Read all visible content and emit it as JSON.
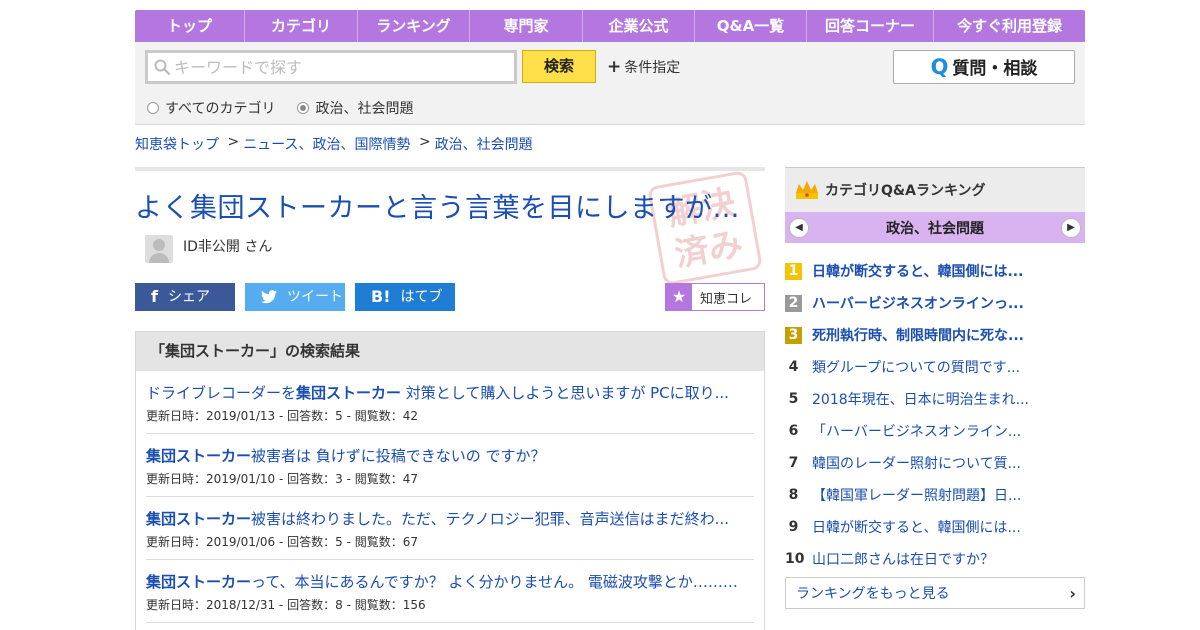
{
  "nav": {
    "items": [
      "トップ",
      "カテゴリ",
      "ランキング",
      "専門家",
      "企業公式",
      "Q&A一覧",
      "回答コーナー",
      "今すぐ利用登録"
    ]
  },
  "search": {
    "placeholder": "キーワードで探す",
    "button": "検索",
    "conditions": "条件指定",
    "ask_button": "質問・相談",
    "scope_all": "すべてのカテゴリ",
    "scope_current": "政治、社会問題",
    "selected_scope": "current"
  },
  "breadcrumb": [
    "知恵袋トップ",
    "ニュース、政治、国際情勢",
    "政治、社会問題"
  ],
  "question": {
    "title": "よく集団ストーカーと言う言葉を目にしますが…",
    "stamp": "解決済み",
    "user": "ID非公開 さん"
  },
  "share": {
    "facebook": "シェア",
    "twitter": "ツイート",
    "hatena": "はてブ",
    "chie_collection": "知恵コレ"
  },
  "results": {
    "heading": "「集団ストーカー」の検索結果",
    "items": [
      {
        "pre": "ドライブレコーダーを",
        "kw": "集団ストーカー",
        "post": " 対策として購入しようと思いますが PCに取り...",
        "meta": "更新日時：2019/01/13 - 回答数：5 - 閲覧数：42"
      },
      {
        "pre": "",
        "kw": "集団ストーカー",
        "post": "被害者は 負けずに投稿できないの ですか？",
        "meta": "更新日時：2019/01/10 - 回答数：3 - 閲覧数：47"
      },
      {
        "pre": "",
        "kw": "集団ストーカー",
        "post": "被害は終わりました。ただ、テクノロジー犯罪、音声送信はまだ終わ...",
        "meta": "更新日時：2019/01/06 - 回答数：5 - 閲覧数：67"
      },
      {
        "pre": "",
        "kw": "集団ストーカー",
        "post": "って、本当にあるんですか？ よく分かりません。 電磁波攻撃とか………",
        "meta": "更新日時：2018/12/31 - 回答数：8 - 閲覧数：156"
      }
    ]
  },
  "ranking": {
    "heading": "カテゴリQ&Aランキング",
    "category": "政治、社会問題",
    "items": [
      {
        "no": "1",
        "title": "日韓が断交すると、韓国側には..."
      },
      {
        "no": "2",
        "title": "ハーバービジネスオンラインっ..."
      },
      {
        "no": "3",
        "title": "死刑執行時、制限時間内に死な..."
      },
      {
        "no": "4",
        "title": "類グループについての質問です..."
      },
      {
        "no": "5",
        "title": "2018年現在、日本に明治生まれ..."
      },
      {
        "no": "6",
        "title": "「ハーバービジネスオンライン..."
      },
      {
        "no": "7",
        "title": "韓国のレーダー照射について質..."
      },
      {
        "no": "8",
        "title": "【韓国軍レーダー照射問題】日..."
      },
      {
        "no": "9",
        "title": "日韓が断交すると、韓国側には..."
      },
      {
        "no": "10",
        "title": "山口二郎さんは在日ですか？"
      }
    ],
    "more": "ランキングをもっと見る"
  },
  "colors": {
    "nav_bg": "#b477e0",
    "link": "#1a4eb0",
    "search_button": "#ffe04a",
    "facebook": "#3b5998",
    "twitter": "#55acee",
    "hatena": "#1f7ed3"
  }
}
